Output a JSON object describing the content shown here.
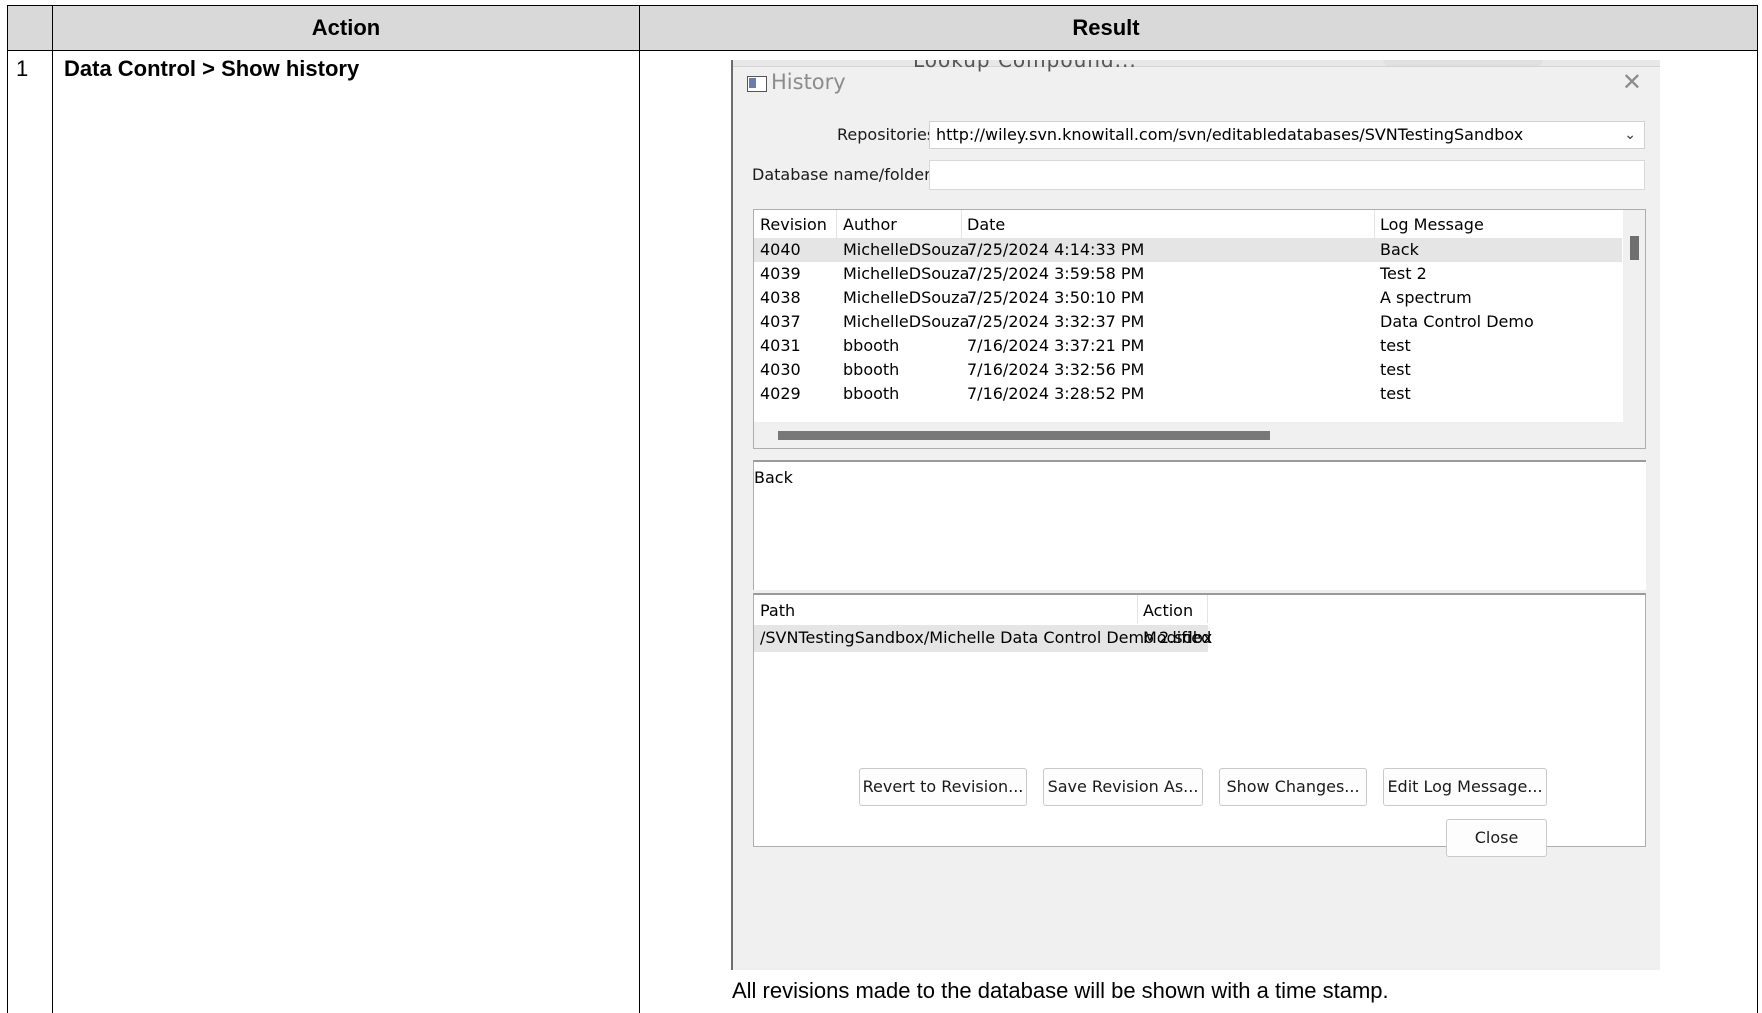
{
  "doc": {
    "headers": {
      "action": "Action",
      "result": "Result"
    },
    "step": {
      "number": "1",
      "action": "Data Control > Show history"
    },
    "caption": "All revisions made to the database will be shown with a time stamp."
  },
  "window": {
    "peek_text": "Lookup Compound...",
    "title": "History",
    "close_glyph": "✕",
    "icon": "window-app-icon"
  },
  "form": {
    "repositories_label": "Repositories:",
    "repositories_value": "http://wiley.svn.knowitall.com/svn/editabledatabases/SVNTestingSandbox",
    "dropdown_icon": "chevron-down-icon",
    "dbname_label": "Database name/folder:",
    "dbname_value": ""
  },
  "revisions": {
    "columns": [
      "Revision",
      "Author",
      "Date",
      "Log Message"
    ],
    "rows": [
      {
        "revision": "4040",
        "author": "MichelleDSouza",
        "date": "7/25/2024 4:14:33 PM",
        "message": "Back",
        "selected": true
      },
      {
        "revision": "4039",
        "author": "MichelleDSouza",
        "date": "7/25/2024 3:59:58 PM",
        "message": "Test 2"
      },
      {
        "revision": "4038",
        "author": "MichelleDSouza",
        "date": "7/25/2024 3:50:10 PM",
        "message": "A spectrum"
      },
      {
        "revision": "4037",
        "author": "MichelleDSouza",
        "date": "7/25/2024 3:32:37 PM",
        "message": "Data Control Demo"
      },
      {
        "revision": "4031",
        "author": "bbooth",
        "date": "7/16/2024 3:37:21 PM",
        "message": "test"
      },
      {
        "revision": "4030",
        "author": "bbooth",
        "date": "7/16/2024 3:32:56 PM",
        "message": "test"
      },
      {
        "revision": "4029",
        "author": "bbooth",
        "date": "7/16/2024 3:28:52 PM",
        "message": "test"
      }
    ]
  },
  "log_message": "Back",
  "paths": {
    "columns": [
      "Path",
      "Action"
    ],
    "rows": [
      {
        "path": "/SVNTestingSandbox/Michelle Data Control Demo 2.sdbx",
        "action": "Modified"
      }
    ]
  },
  "buttons": {
    "revert": "Revert to Revision...",
    "save_as": "Save Revision As...",
    "show_changes": "Show Changes...",
    "edit_log": "Edit Log Message...",
    "close": "Close"
  }
}
